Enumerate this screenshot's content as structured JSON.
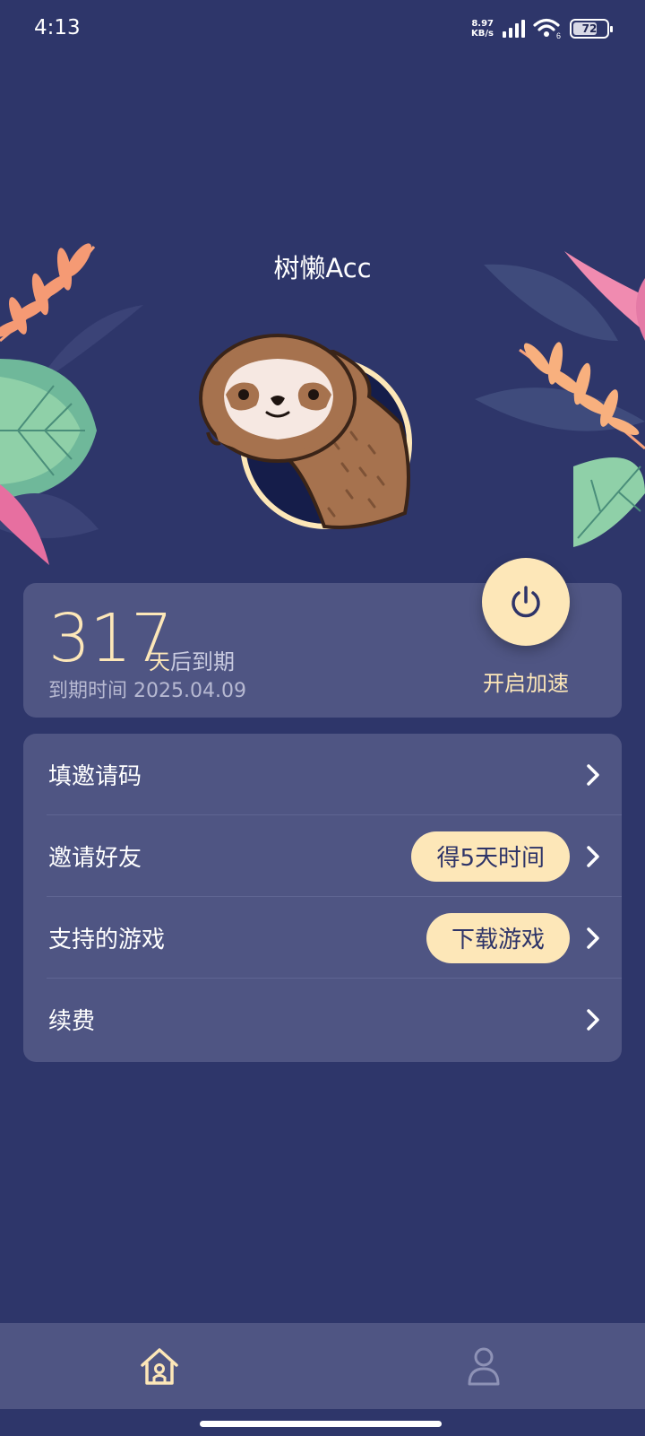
{
  "status_bar": {
    "time": "4:13",
    "net_speed_value": "8.97",
    "net_speed_unit": "KB/s",
    "battery": "72",
    "battery_level": 0.72,
    "wifi_label": "6"
  },
  "header": {
    "app_title": "树懒Acc"
  },
  "expiry": {
    "days": "317",
    "unit_day": "天",
    "unit_suffix": "后到期",
    "date_label": "到期时间 2025.04.09",
    "power_label": "开启加速"
  },
  "menu": {
    "items": [
      {
        "label": "填邀请码"
      },
      {
        "label": "邀请好友",
        "badge": "得5天时间"
      },
      {
        "label": "支持的游戏",
        "badge": "下载游戏"
      },
      {
        "label": "续费"
      }
    ]
  },
  "nav": {
    "home_icon": "home-icon",
    "profile_icon": "profile-icon"
  },
  "colors": {
    "background": "#2e366a",
    "card": "#4f5583",
    "accent": "#fde7b8"
  }
}
